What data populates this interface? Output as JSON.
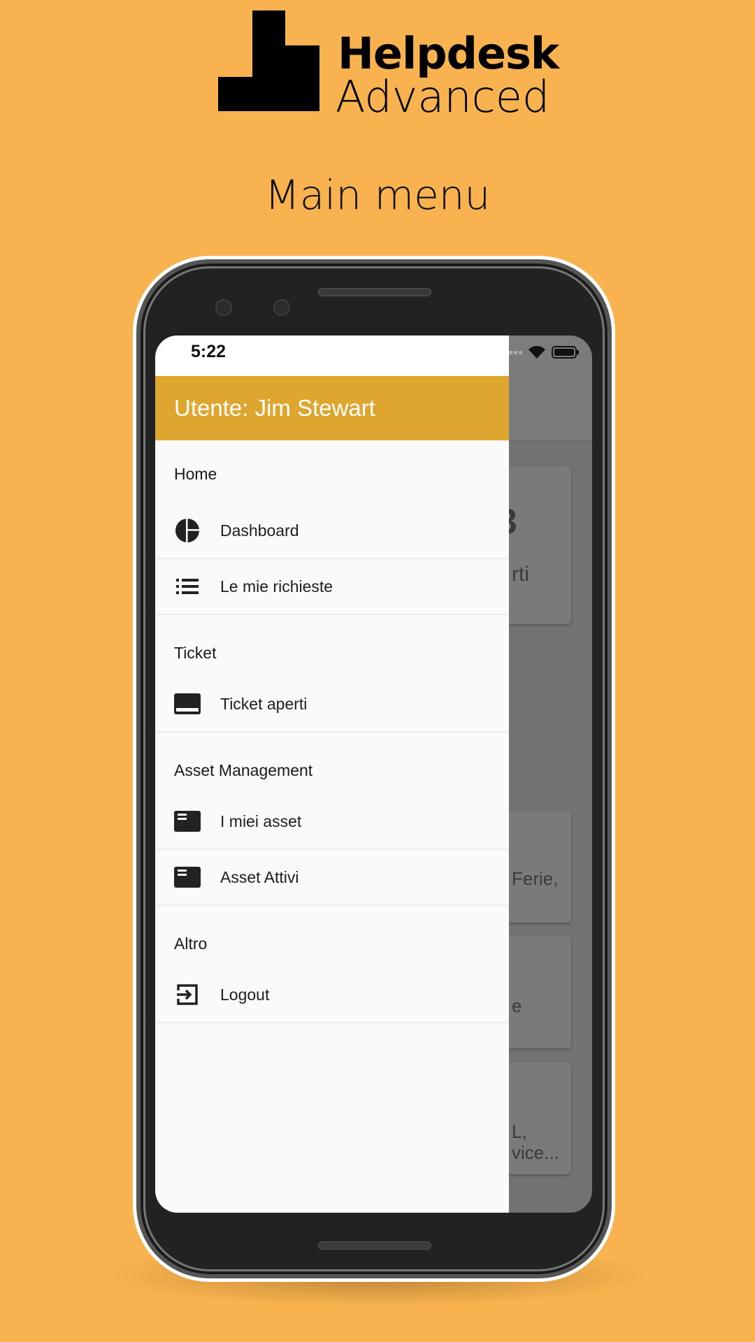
{
  "brand": {
    "line1": "Helpdesk",
    "line2": "Advanced"
  },
  "page_title": "Main menu",
  "status_bar": {
    "time": "5:22"
  },
  "drawer": {
    "header": "Utente: Jim Stewart",
    "header_color": "#DEA52F",
    "sections": [
      {
        "title": "Home",
        "items": [
          {
            "label": "Dashboard",
            "icon": "pie-chart-icon"
          },
          {
            "label": "Le mie richieste",
            "icon": "list-icon"
          }
        ]
      },
      {
        "title": "Ticket",
        "items": [
          {
            "label": "Ticket aperti",
            "icon": "inbox-icon"
          }
        ]
      },
      {
        "title": "Asset Management",
        "items": [
          {
            "label": "I miei asset",
            "icon": "asset-card-icon"
          },
          {
            "label": "Asset Attivi",
            "icon": "asset-card-icon"
          }
        ]
      },
      {
        "title": "Altro",
        "items": [
          {
            "label": "Logout",
            "icon": "logout-icon"
          }
        ]
      }
    ]
  },
  "background_cards": [
    {
      "line1": "3",
      "line2": "rti"
    },
    {
      "line1": "Ferie,"
    },
    {
      "line1": "e"
    },
    {
      "line1": "L,",
      "line2": "vice..."
    }
  ],
  "colors": {
    "background": "#F8B24F",
    "scrim": "#727272"
  }
}
